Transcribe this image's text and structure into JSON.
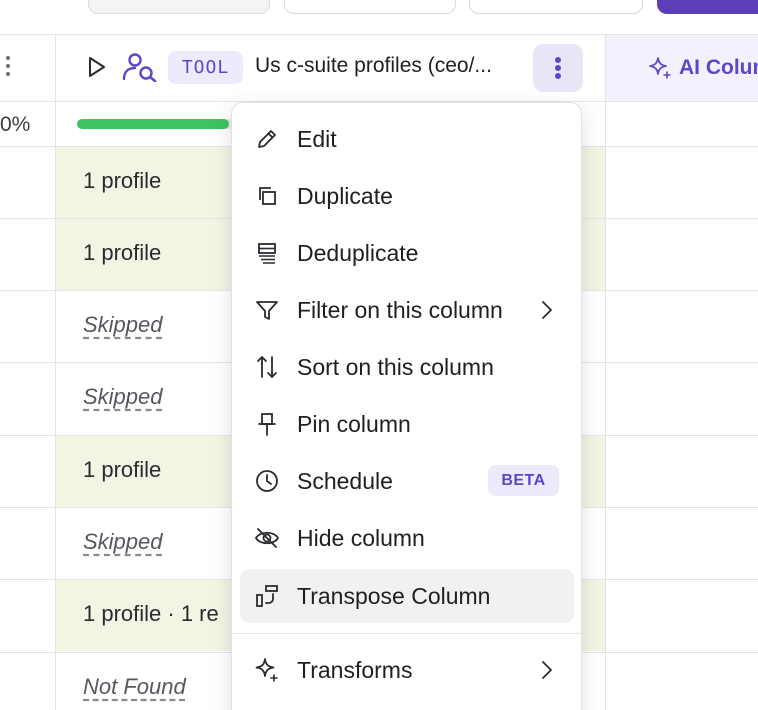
{
  "header": {
    "tool_badge": "TOOL",
    "column_title": "Us c-suite profiles (ceo/...",
    "ai_column_label": "AI Colum"
  },
  "progress": {
    "left_percent_text": "0%",
    "fill_fraction": 0.95
  },
  "rows": [
    {
      "text": "1 profile",
      "status": "filled"
    },
    {
      "text": "1 profile",
      "status": "filled"
    },
    {
      "text": "Skipped",
      "status": "skipped"
    },
    {
      "text": "Skipped",
      "status": "skipped"
    },
    {
      "text": "1 profile",
      "status": "filled"
    },
    {
      "text": "Skipped",
      "status": "skipped"
    },
    {
      "text": "1 profile · 1 re",
      "status": "filled"
    },
    {
      "text": "Not Found",
      "status": "skipped"
    }
  ],
  "menu": {
    "items": [
      {
        "label": "Edit",
        "icon": "pencil-icon"
      },
      {
        "label": "Duplicate",
        "icon": "copy-icon"
      },
      {
        "label": "Deduplicate",
        "icon": "stack-icon"
      },
      {
        "label": "Filter on this column",
        "icon": "funnel-icon",
        "submenu": true
      },
      {
        "label": "Sort on this column",
        "icon": "sort-icon"
      },
      {
        "label": "Pin column",
        "icon": "pin-icon"
      },
      {
        "label": "Schedule",
        "icon": "clock-icon",
        "badge": "BETA"
      },
      {
        "label": "Hide column",
        "icon": "eye-off-icon"
      },
      {
        "label": "Transpose Column",
        "icon": "transpose-icon",
        "hovered": true
      },
      {
        "label": "Transforms",
        "icon": "sparkle-icon",
        "submenu": true
      }
    ]
  },
  "colors": {
    "accent": "#5a48c9",
    "progress_green": "#3ec35e",
    "filled_cell": "#f1f5e4",
    "ai_header_bg": "#f3f1fd"
  }
}
